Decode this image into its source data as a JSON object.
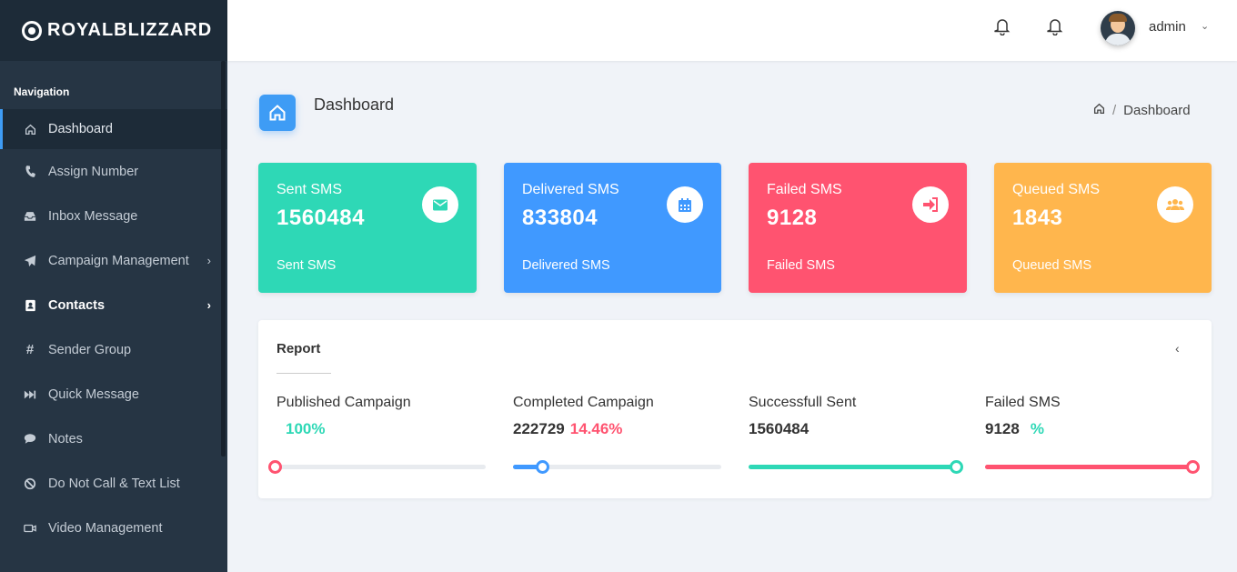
{
  "brand": {
    "name": "ROYALBLIZZARD"
  },
  "sidebar": {
    "section_title": "Navigation",
    "items": [
      {
        "label": "Dashboard",
        "icon": "home-icon"
      },
      {
        "label": "Assign Number",
        "icon": "phone-icon"
      },
      {
        "label": "Inbox Message",
        "icon": "inbox-icon"
      },
      {
        "label": "Campaign Management",
        "icon": "send-icon"
      },
      {
        "label": "Contacts",
        "icon": "contact-book-icon"
      },
      {
        "label": "Sender Group",
        "icon": "hashtag-icon"
      },
      {
        "label": "Quick Message",
        "icon": "fast-forward-icon"
      },
      {
        "label": "Notes",
        "icon": "comment-icon"
      },
      {
        "label": "Do Not Call & Text List",
        "icon": "ban-icon"
      },
      {
        "label": "Video Management",
        "icon": "video-icon"
      }
    ]
  },
  "topbar": {
    "user_name": "admin"
  },
  "page": {
    "title": "Dashboard",
    "breadcrumb_current": "Dashboard"
  },
  "cards": [
    {
      "label": "Sent SMS",
      "value": "1560484",
      "footer": "Sent SMS",
      "color": "#2ed8b6",
      "icon": "envelope-icon"
    },
    {
      "label": "Delivered SMS",
      "value": "833804",
      "footer": "Delivered SMS",
      "color": "#4099ff",
      "icon": "calendar-icon"
    },
    {
      "label": "Failed SMS",
      "value": "9128",
      "footer": "Failed SMS",
      "color": "#ff5370",
      "icon": "sign-in-icon"
    },
    {
      "label": "Queued SMS",
      "value": "1843",
      "footer": "Queued SMS",
      "color": "#ffb64d",
      "icon": "users-icon"
    }
  ],
  "report": {
    "title": "Report",
    "metrics": [
      {
        "label": "Published Campaign",
        "number": "",
        "percent": "100%",
        "percent_color": "#2ed8b6",
        "bar_color": "#ff5370",
        "progress": 0
      },
      {
        "label": "Completed Campaign",
        "number": "222729",
        "percent": "14.46%",
        "percent_color": "#ff5370",
        "bar_color": "#4099ff",
        "progress": 0.14
      },
      {
        "label": "Successfull Sent",
        "number": "1560484",
        "percent": "",
        "percent_color": "#2ed8b6",
        "bar_color": "#2ed8b6",
        "progress": 1
      },
      {
        "label": "Failed SMS",
        "number": "9128",
        "percent": "%",
        "percent_color": "#2ed8b6",
        "bar_color": "#ff5370",
        "progress": 1
      }
    ]
  }
}
